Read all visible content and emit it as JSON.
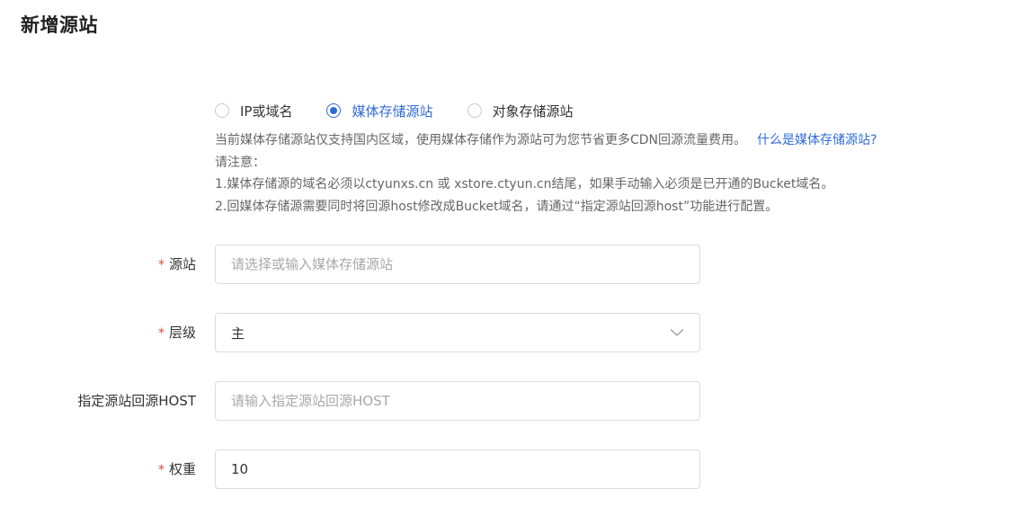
{
  "page": {
    "title": "新增源站"
  },
  "origin_type": {
    "options": [
      {
        "label": "IP或域名",
        "checked": false
      },
      {
        "label": "媒体存储源站",
        "checked": true
      },
      {
        "label": "对象存储源站",
        "checked": false
      }
    ]
  },
  "notes": {
    "line1": "当前媒体存储源站仅支持国内区域，使用媒体存储作为源站可为您节省更多CDN回源流量费用。",
    "help_link": "什么是媒体存储源站?",
    "line2": "请注意：",
    "line3": "1.媒体存储源的域名必须以ctyunxs.cn 或 xstore.ctyun.cn结尾，如果手动输入必须是已开通的Bucket域名。",
    "line4": "2.回媒体存储源需要同时将回源host修改成Bucket域名，请通过“指定源站回源host”功能进行配置。"
  },
  "form": {
    "origin": {
      "label": "源站",
      "required": "*",
      "placeholder": "请选择或输入媒体存储源站",
      "value": ""
    },
    "level": {
      "label": "层级",
      "required": "*",
      "value": "主"
    },
    "host": {
      "label": "指定源站回源HOST",
      "placeholder": "请输入指定源站回源HOST",
      "value": ""
    },
    "weight": {
      "label": "权重",
      "required": "*",
      "value": "10"
    }
  },
  "colors": {
    "accent": "#2f6bd6",
    "required": "#e0463a",
    "border": "#dcdcdc"
  },
  "icons": {
    "level_select": "chevron-down-icon"
  }
}
